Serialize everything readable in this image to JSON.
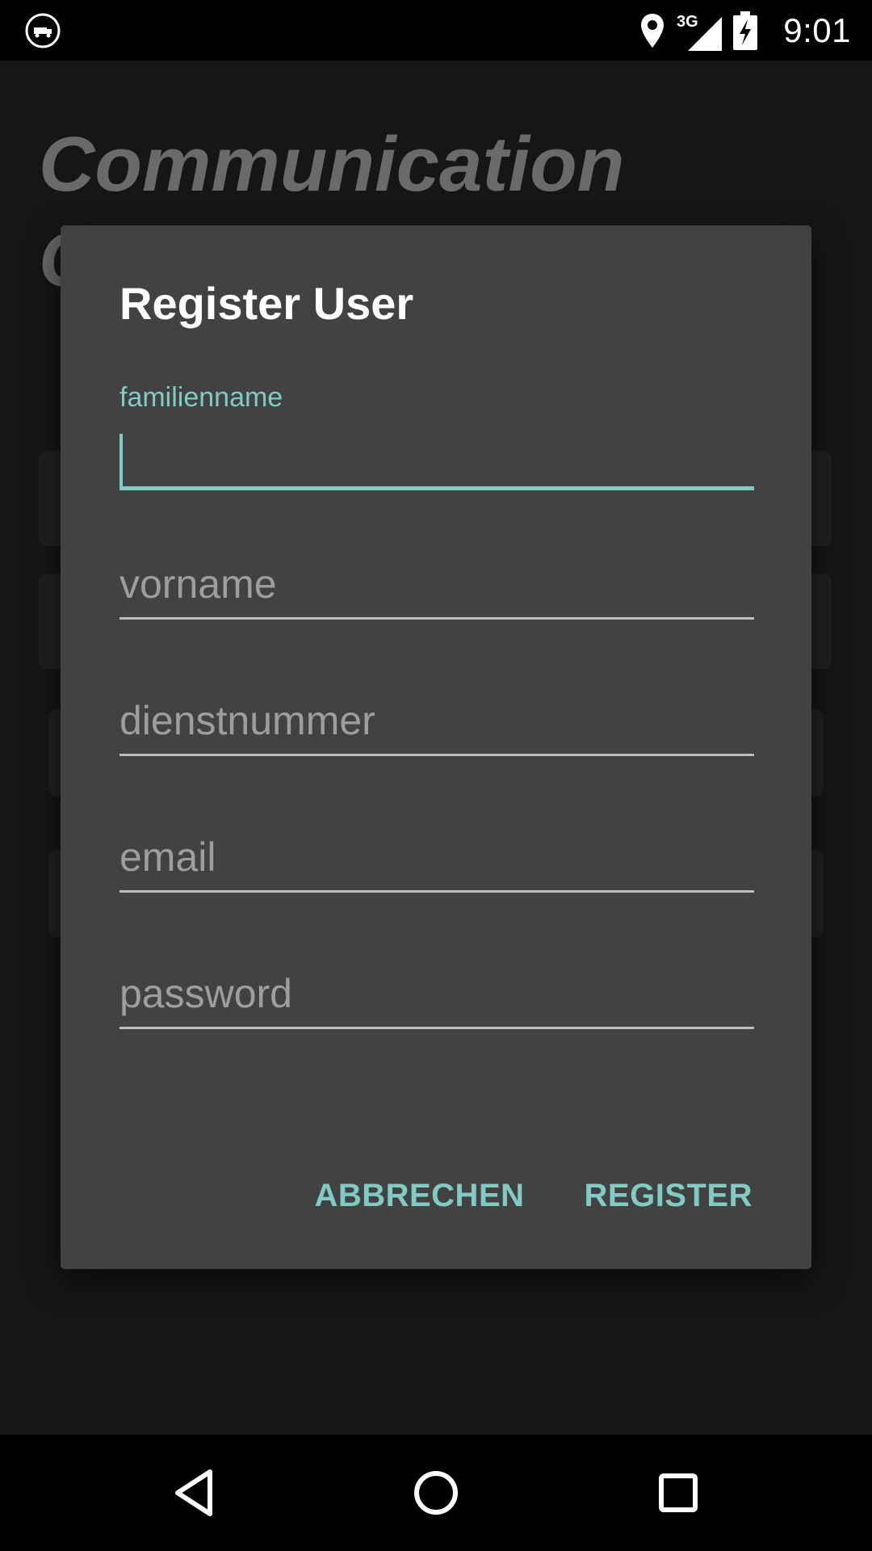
{
  "status_bar": {
    "time": "9:01",
    "network": "3G",
    "icons": [
      "app-notification-icon",
      "location-pin-icon",
      "signal-icon",
      "battery-charging-icon"
    ]
  },
  "app": {
    "title": "Communication Center Cli"
  },
  "dialog": {
    "title": "Register User",
    "fields": [
      {
        "name": "familienname",
        "label": "familienname",
        "placeholder": "",
        "value": "",
        "focused": true
      },
      {
        "name": "vorname",
        "placeholder": "vorname",
        "value": ""
      },
      {
        "name": "dienstnummer",
        "placeholder": "dienstnummer",
        "value": ""
      },
      {
        "name": "email",
        "placeholder": "email",
        "value": ""
      },
      {
        "name": "password",
        "placeholder": "password",
        "value": ""
      }
    ],
    "buttons": {
      "cancel": "ABBRECHEN",
      "register": "REGISTER"
    }
  },
  "nav_bar": {
    "icons": [
      "back-icon",
      "home-icon",
      "recents-icon"
    ]
  },
  "colors": {
    "accent": "#80cbc4",
    "dialog_background": "#424242",
    "screen_background": "#161616",
    "title_faded": "#6a6a6a"
  }
}
